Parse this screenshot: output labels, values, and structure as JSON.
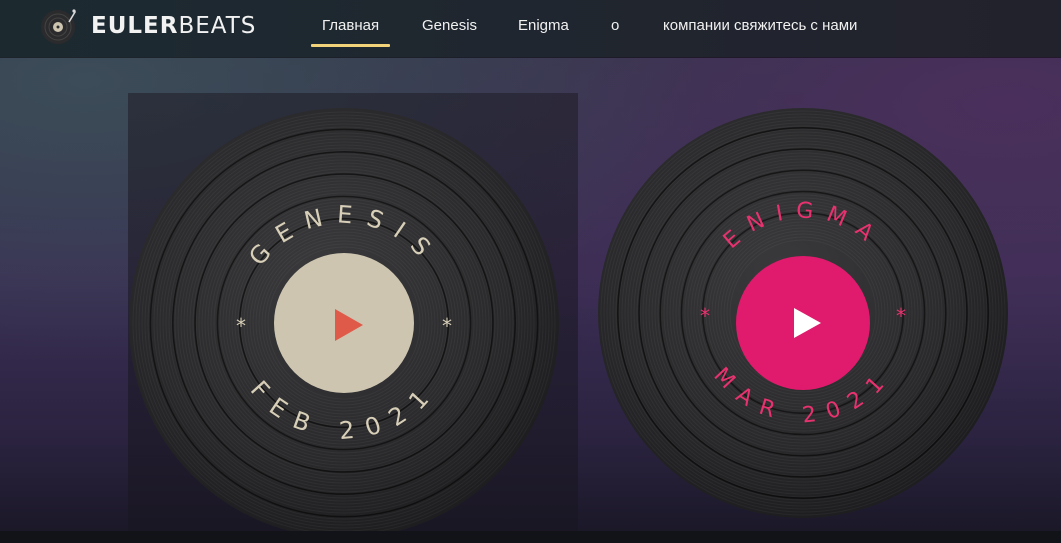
{
  "header": {
    "logo_bold": "EULER",
    "logo_light": "BEATS",
    "logo_icon": "turntable-icon",
    "nav": [
      {
        "label": "Главная",
        "active": true
      },
      {
        "label": "Genesis",
        "active": false
      },
      {
        "label": "Enigma",
        "active": false
      },
      {
        "label": "о",
        "active": false
      },
      {
        "label": "компании свяжитесь с нами",
        "active": false
      }
    ]
  },
  "records": [
    {
      "name": "GENESIS",
      "date": "FEB 2021",
      "star": "*",
      "label_color": "#cdc5b0",
      "text_color": "#d8cfb8",
      "play_color": "#e05a4a",
      "play_icon": "play-icon"
    },
    {
      "name": "ENIGMA",
      "date": "MAR 2021",
      "star": "*",
      "label_color": "#e01a6c",
      "text_color": "#e8326f",
      "play_color": "#ffffff",
      "play_icon": "play-icon"
    }
  ],
  "colors": {
    "accent": "#f2d37a",
    "vinyl": "#2b2b2d"
  }
}
